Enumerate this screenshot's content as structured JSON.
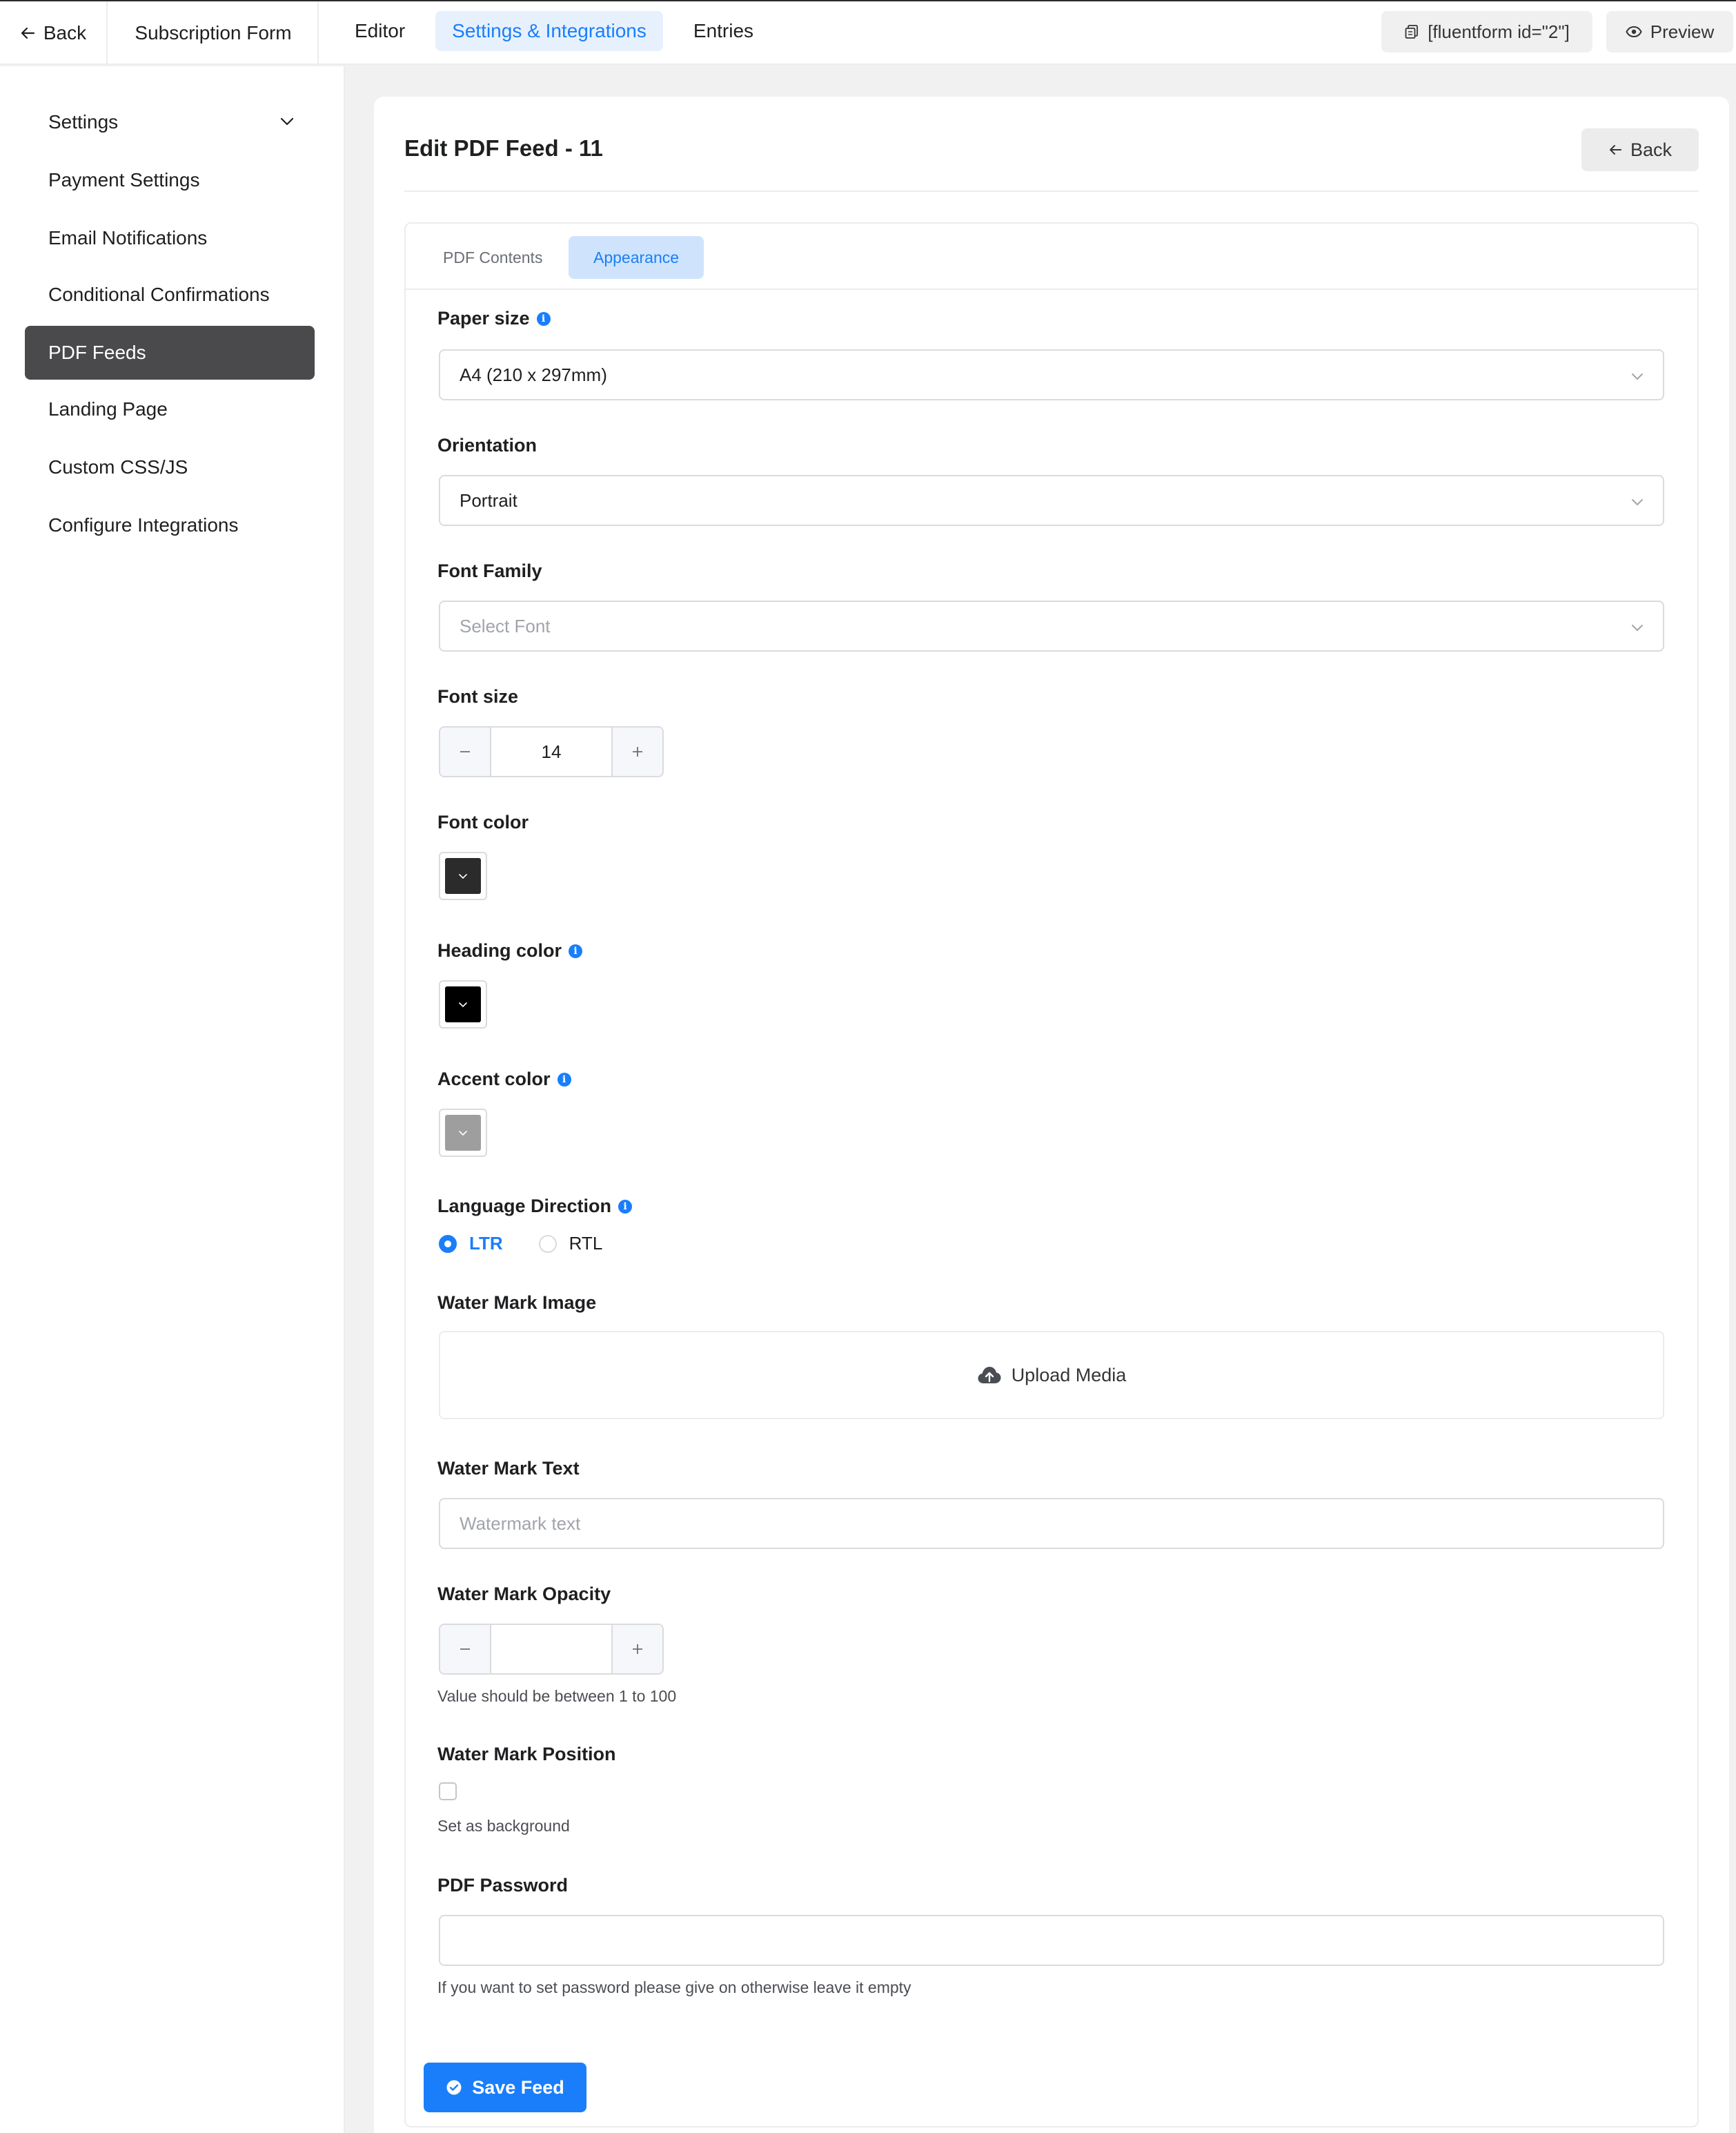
{
  "topbar": {
    "back_label": "Back",
    "form_title": "Subscription Form",
    "nav": [
      {
        "label": "Editor",
        "active": false
      },
      {
        "label": "Settings & Integrations",
        "active": true
      },
      {
        "label": "Entries",
        "active": false
      }
    ],
    "shortcode": "[fluentform id=\"2\"]",
    "preview_label": "Preview"
  },
  "sidebar": {
    "items": [
      {
        "label": "Settings",
        "active": false,
        "has_chevron": true
      },
      {
        "label": "Payment Settings",
        "active": false
      },
      {
        "label": "Email Notifications",
        "active": false
      },
      {
        "label": "Conditional Confirmations",
        "active": false
      },
      {
        "label": "PDF Feeds",
        "active": true
      },
      {
        "label": "Landing Page",
        "active": false
      },
      {
        "label": "Custom CSS/JS",
        "active": false
      },
      {
        "label": "Configure Integrations",
        "active": false
      }
    ]
  },
  "main": {
    "title": "Edit PDF Feed - 11",
    "back_label": "Back",
    "tabs": [
      {
        "label": "PDF Contents",
        "active": false
      },
      {
        "label": "Appearance",
        "active": true
      }
    ],
    "form": {
      "paper_size": {
        "label": "Paper size",
        "value": "A4 (210 x 297mm)"
      },
      "orientation": {
        "label": "Orientation",
        "value": "Portrait"
      },
      "font_family": {
        "label": "Font Family",
        "placeholder": "Select Font"
      },
      "font_size": {
        "label": "Font size",
        "value": "14"
      },
      "font_color": {
        "label": "Font color",
        "color": "#2b2b2b"
      },
      "heading_color": {
        "label": "Heading color",
        "color": "#000000"
      },
      "accent_color": {
        "label": "Accent color",
        "color": "#9e9e9e"
      },
      "language_direction": {
        "label": "Language Direction",
        "options": [
          {
            "label": "LTR",
            "checked": true
          },
          {
            "label": "RTL",
            "checked": false
          }
        ]
      },
      "watermark_image": {
        "label": "Water Mark Image",
        "upload_label": "Upload Media"
      },
      "watermark_text": {
        "label": "Water Mark Text",
        "placeholder": "Watermark text"
      },
      "watermark_opacity": {
        "label": "Water Mark Opacity",
        "value": "",
        "help": "Value should be between 1 to 100"
      },
      "watermark_position": {
        "label": "Water Mark Position",
        "checkbox_label": "Set as background"
      },
      "pdf_password": {
        "label": "PDF Password",
        "value": "",
        "help": "If you want to set password please give on otherwise leave it empty"
      }
    },
    "save_label": "Save Feed"
  },
  "colors": {
    "accent": "#1a7efb",
    "active_sidebar": "#4a4a4c",
    "active_tab_bg": "#cfe4fc"
  }
}
